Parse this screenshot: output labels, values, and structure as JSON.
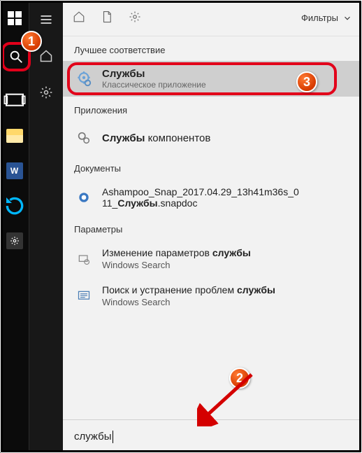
{
  "panel": {
    "filters_label": "Фильтры",
    "best_match_header": "Лучшее соответствие",
    "best_match": {
      "title": "Службы",
      "subtitle": "Классическое приложение"
    },
    "apps_header": "Приложения",
    "apps_item_prefix": "Службы",
    "apps_item_rest": " компонентов",
    "docs_header": "Документы",
    "docs_item_line1": "Ashampoo_Snap_2017.04.29_13h41m36s_0",
    "docs_item_prefix": "11_",
    "docs_item_bold": "Службы",
    "docs_item_suffix": ".snapdoc",
    "settings_header": "Параметры",
    "setting1_prefix": "Изменение параметров ",
    "setting1_bold": "службы",
    "setting1_line2": "Windows Search",
    "setting2_prefix": "Поиск и устранение проблем ",
    "setting2_bold": "службы",
    "setting2_line2": "Windows Search",
    "search_value": "службы"
  },
  "badges": {
    "b1": "1",
    "b2": "2",
    "b3": "3"
  }
}
